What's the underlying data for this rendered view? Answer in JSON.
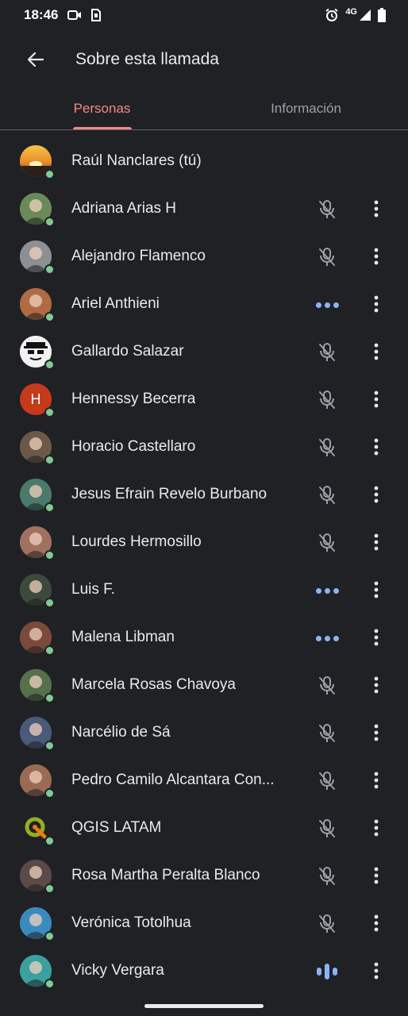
{
  "status_bar": {
    "time": "18:46",
    "network": "4G"
  },
  "app_bar": {
    "title": "Sobre esta llamada"
  },
  "tabs": [
    {
      "label": "Personas",
      "active": true
    },
    {
      "label": "Información",
      "active": false
    }
  ],
  "colors": {
    "background": "#202124",
    "accent": "#f28b82",
    "presence": "#81c995",
    "speaking": "#8ab4f8",
    "muted_icon": "#9aa0a6"
  },
  "participants": [
    {
      "name": "Raúl Nanclares (tú)",
      "mic": "none",
      "avatar": "sunset",
      "avatar_color": "#e8a33d"
    },
    {
      "name": "Adriana Arias H",
      "mic": "muted",
      "avatar": "photo",
      "avatar_color": "#6a8a5a"
    },
    {
      "name": "Alejandro Flamenco",
      "mic": "muted",
      "avatar": "photo",
      "avatar_color": "#8c8f94"
    },
    {
      "name": "Ariel Anthieni",
      "mic": "speaking-dots",
      "avatar": "photo",
      "avatar_color": "#b06a45"
    },
    {
      "name": "Gallardo Salazar",
      "mic": "muted",
      "avatar": "cartoon",
      "avatar_color": "#f1f1f1"
    },
    {
      "name": "Hennessy Becerra",
      "mic": "muted",
      "avatar": "letter",
      "avatar_letter": "H",
      "avatar_color": "#c53a1a"
    },
    {
      "name": "Horacio Castellaro",
      "mic": "muted",
      "avatar": "photo",
      "avatar_color": "#6b5a4a"
    },
    {
      "name": "Jesus Efrain Revelo Burbano",
      "mic": "muted",
      "avatar": "photo",
      "avatar_color": "#4a7a6a"
    },
    {
      "name": "Lourdes Hermosillo",
      "mic": "muted",
      "avatar": "photo",
      "avatar_color": "#a07060"
    },
    {
      "name": "Luis F.",
      "mic": "speaking-dots",
      "avatar": "photo",
      "avatar_color": "#3c4a3c"
    },
    {
      "name": "Malena Libman",
      "mic": "speaking-dots",
      "avatar": "photo",
      "avatar_color": "#7a4a3a"
    },
    {
      "name": "Marcela Rosas Chavoya",
      "mic": "muted",
      "avatar": "photo",
      "avatar_color": "#55704a"
    },
    {
      "name": "Narcélio de Sá",
      "mic": "muted",
      "avatar": "photo",
      "avatar_color": "#4a5a7a"
    },
    {
      "name": "Pedro Camilo Alcantara Con...",
      "mic": "muted",
      "avatar": "photo",
      "avatar_color": "#9a6a55"
    },
    {
      "name": "QGIS LATAM",
      "mic": "muted",
      "avatar": "qgis-logo",
      "avatar_color": "#202124"
    },
    {
      "name": "Rosa Martha Peralta Blanco",
      "mic": "muted",
      "avatar": "photo",
      "avatar_color": "#5a4a48"
    },
    {
      "name": "Verónica Totolhua",
      "mic": "muted",
      "avatar": "photo",
      "avatar_color": "#3a8ac0"
    },
    {
      "name": "Vicky Vergara",
      "mic": "speaking-bars",
      "avatar": "photo",
      "avatar_color": "#3aa0a0"
    }
  ]
}
